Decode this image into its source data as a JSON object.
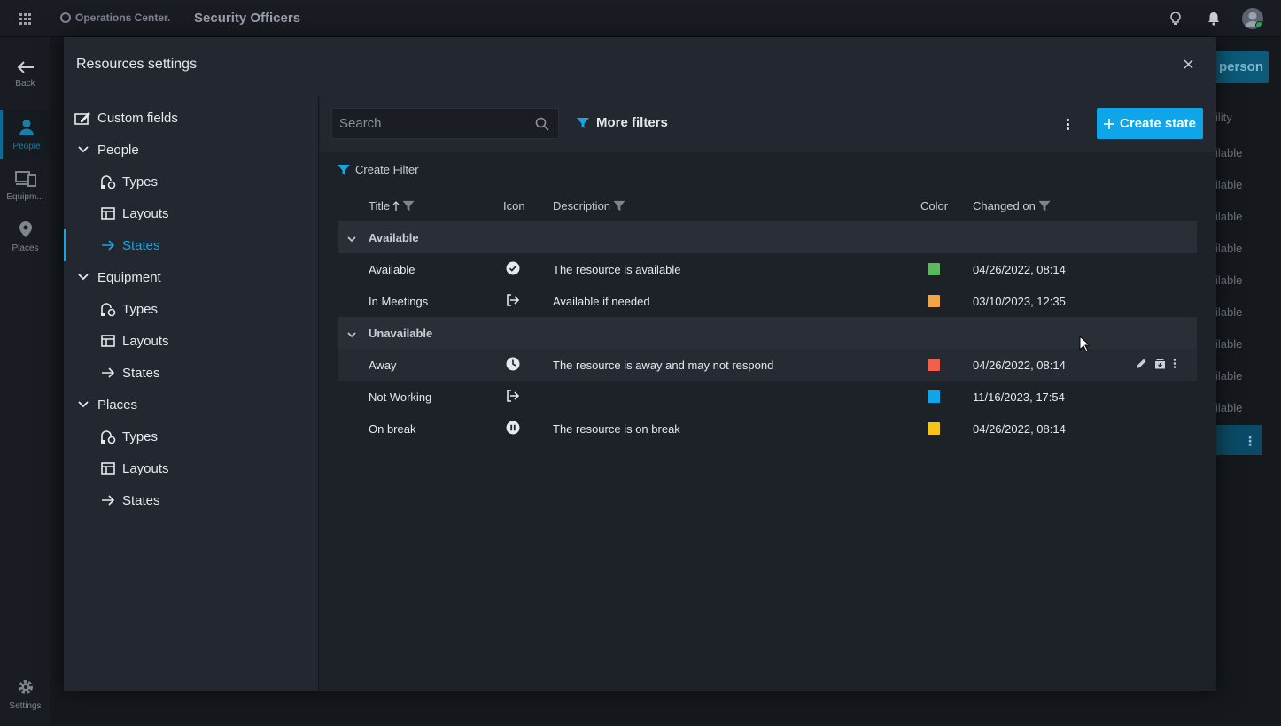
{
  "topbar": {
    "brand": "Operations Center.",
    "title": "Security Officers"
  },
  "rail": {
    "back": "Back",
    "people": "People",
    "equipment": "Equipm...",
    "places": "Places",
    "settings": "Settings"
  },
  "background": {
    "add_button": "person",
    "column_header": "ility",
    "cells": [
      "ilable",
      "ilable",
      "ilable",
      "ilable",
      "ilable",
      "ilable",
      "ilable",
      "ilable",
      "ilable"
    ]
  },
  "modal": {
    "title": "Resources settings"
  },
  "sidenav": {
    "custom_fields": "Custom fields",
    "sections": [
      {
        "label": "People",
        "items": [
          "Types",
          "Layouts",
          "States"
        ]
      },
      {
        "label": "Equipment",
        "items": [
          "Types",
          "Layouts",
          "States"
        ]
      },
      {
        "label": "Places",
        "items": [
          "Types",
          "Layouts",
          "States"
        ]
      }
    ],
    "active": "People > States"
  },
  "toolbar": {
    "search_placeholder": "Search",
    "more_filters": "More filters",
    "create_state": "Create state"
  },
  "create_filter": "Create Filter",
  "table": {
    "headers": {
      "title": "Title",
      "icon": "Icon",
      "description": "Description",
      "color": "Color",
      "changed_on": "Changed on"
    },
    "groups": [
      {
        "label": "Available",
        "rows": [
          {
            "title": "Available",
            "icon": "check-circle-icon",
            "description": "The resource is available",
            "color": "#5cb85c",
            "changed_on": "04/26/2022, 08:14"
          },
          {
            "title": "In Meetings",
            "icon": "logout-arrow-icon",
            "description": "Available if needed",
            "color": "#f0a448",
            "changed_on": "03/10/2023, 12:35"
          }
        ]
      },
      {
        "label": "Unavailable",
        "rows": [
          {
            "title": "Away",
            "icon": "clock-icon",
            "description": "The resource is away and may not respond",
            "color": "#f0604d",
            "changed_on": "04/26/2022, 08:14"
          },
          {
            "title": "Not Working",
            "icon": "logout-arrow-icon",
            "description": "",
            "color": "#0ea5e9",
            "changed_on": "11/16/2023, 17:54"
          },
          {
            "title": "On break",
            "icon": "pause-circle-icon",
            "description": "The resource is on break",
            "color": "#f5c518",
            "changed_on": "04/26/2022, 08:14"
          }
        ]
      }
    ]
  }
}
